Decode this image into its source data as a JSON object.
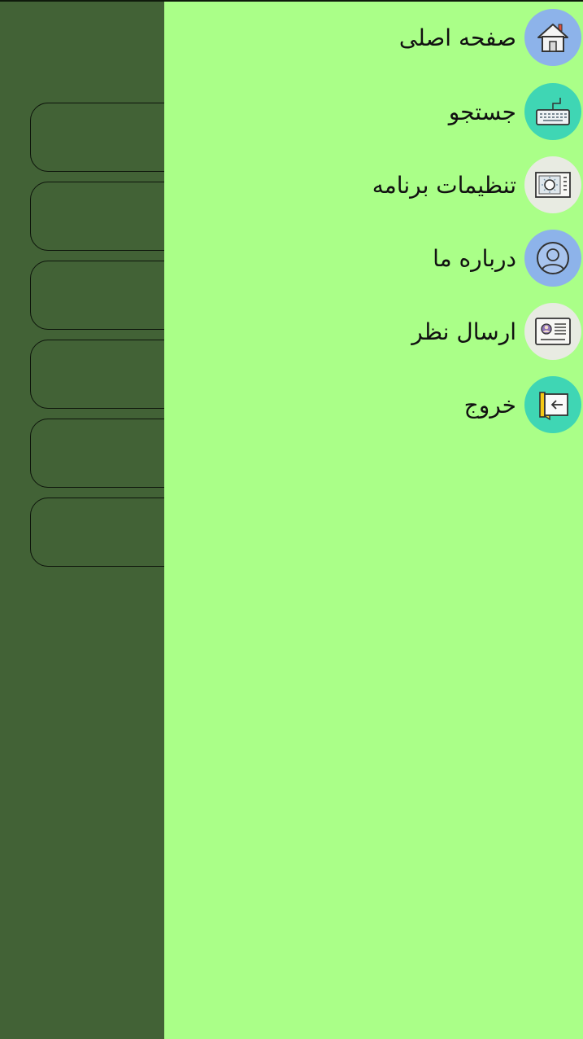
{
  "menu": {
    "items": [
      {
        "label": "صفحه اصلی",
        "icon": "home-icon",
        "color": "#8db3ea"
      },
      {
        "label": "جستجو",
        "icon": "keyboard-icon",
        "color": "#3fd6b4"
      },
      {
        "label": "تنظیمات برنامه",
        "icon": "settings-panel-icon",
        "color": "#e8ebe2"
      },
      {
        "label": "درباره ما",
        "icon": "user-icon",
        "color": "#8db3ea"
      },
      {
        "label": "ارسال نظر",
        "icon": "id-card-icon",
        "color": "#e8ebe2"
      },
      {
        "label": "خروج",
        "icon": "exit-icon",
        "color": "#3fd6b4"
      }
    ]
  },
  "colors": {
    "drawer_background": "#aaff88",
    "dimmed_background": "#426236"
  }
}
